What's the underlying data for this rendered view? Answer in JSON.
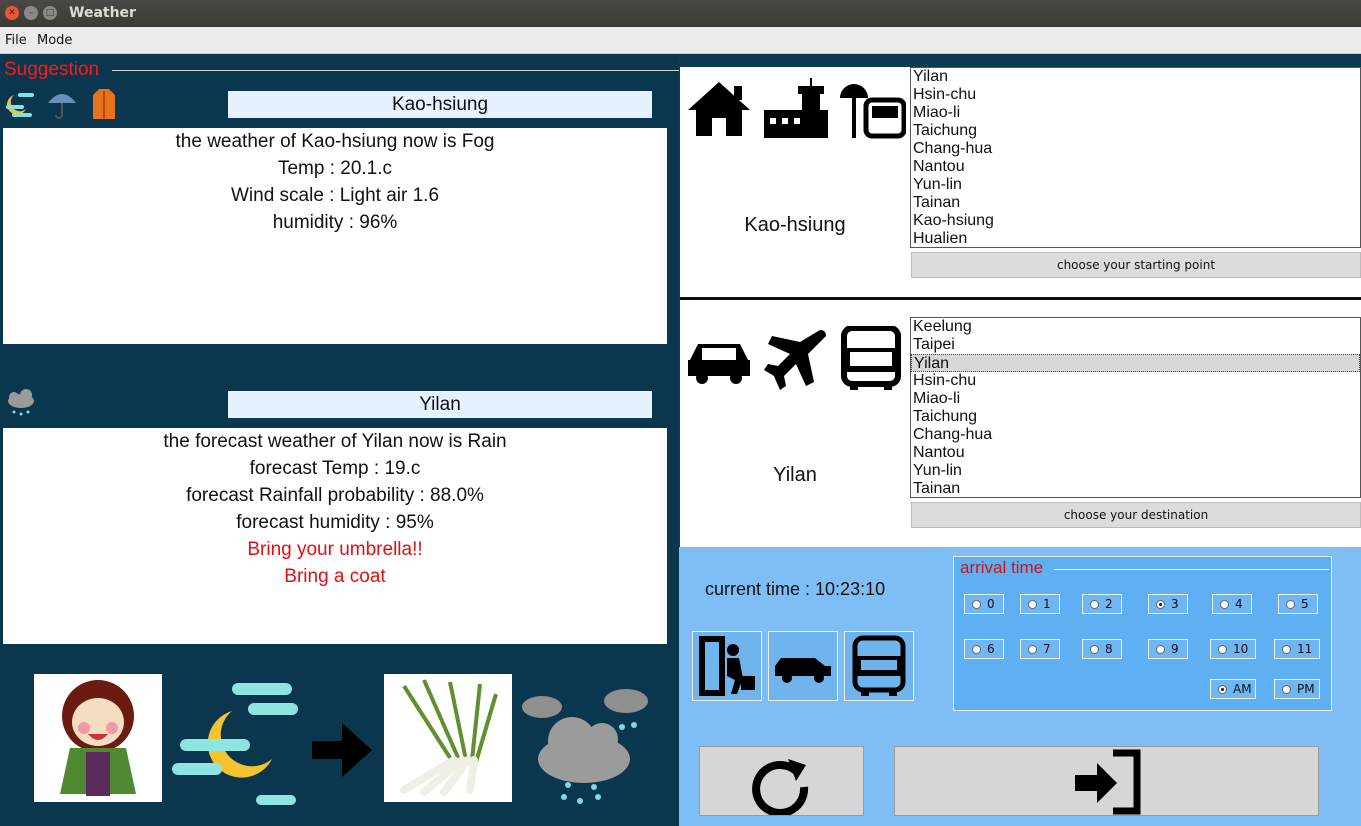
{
  "window": {
    "title": "Weather"
  },
  "menu": {
    "file": "File",
    "mode": "Mode"
  },
  "suggestion": {
    "label": "Suggestion",
    "current": {
      "city": "Kao-hsiung",
      "lines": [
        "the weather of Kao-hsiung now is Fog",
        "Temp : 20.1.c",
        "Wind scale : Light air 1.6",
        "humidity : 96%"
      ]
    },
    "forecast": {
      "city": "Yilan",
      "lines": [
        "the forecast weather of Yilan now is Rain",
        "forecast Temp : 19.c",
        "forecast Rainfall probability : 88.0%",
        "forecast humidity : 95%"
      ],
      "advice": [
        "Bring your umbrella!!",
        "Bring a coat"
      ]
    }
  },
  "start": {
    "selected_city": "Kao-hsiung",
    "list": [
      "Yilan",
      "Hsin-chu",
      "Miao-li",
      "Taichung",
      "Chang-hua",
      "Nantou",
      "Yun-lin",
      "Tainan",
      "Kao-hsiung",
      "Hualien"
    ],
    "button": "choose your starting point"
  },
  "destination": {
    "selected_city": "Yilan",
    "list": [
      "Keelung",
      "Taipei",
      "Yilan",
      "Hsin-chu",
      "Miao-li",
      "Taichung",
      "Chang-hua",
      "Nantou",
      "Yun-lin",
      "Tainan"
    ],
    "highlighted": "Yilan",
    "button": "choose your destination"
  },
  "time": {
    "current": "current time : 10:23:10"
  },
  "arrival": {
    "title": "arrival time",
    "hours": [
      "0",
      "1",
      "2",
      "3",
      "4",
      "5",
      "6",
      "7",
      "8",
      "9",
      "10",
      "11"
    ],
    "selected_hour": "3",
    "ampm": [
      "AM",
      "PM"
    ],
    "selected_ampm": "AM"
  },
  "colors": {
    "left_bg": "#0a364e",
    "right_bottom_bg": "#7fbef4",
    "accent_red": "#e01010"
  }
}
